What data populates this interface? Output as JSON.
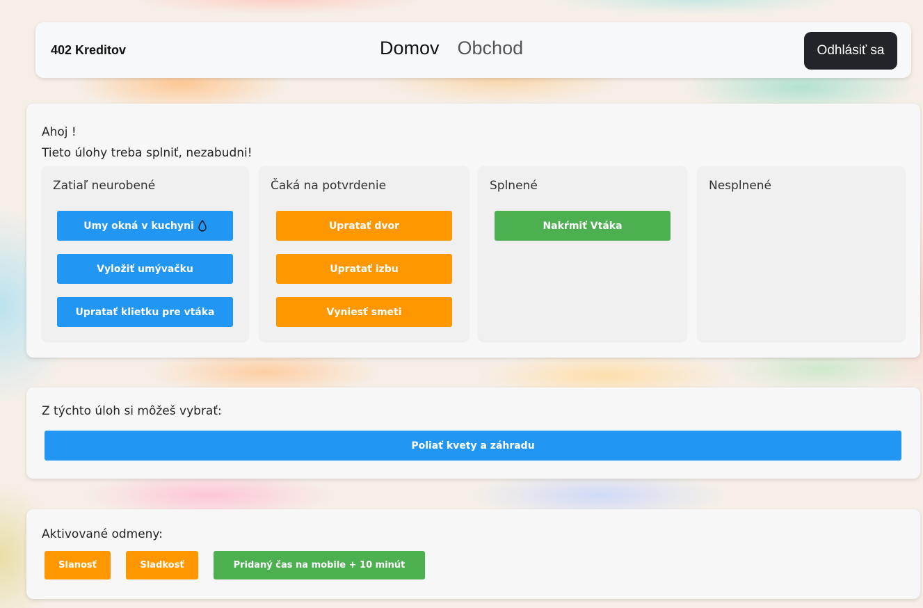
{
  "header": {
    "credits": "402 Kreditov",
    "nav": {
      "home": "Domov",
      "shop": "Obchod"
    },
    "logout_label": "Odhlásiť sa"
  },
  "tasks": {
    "greeting": "Ahoj !",
    "subtitle": "Tieto úlohy treba splniť, nezabudni!",
    "columns": {
      "todo": {
        "title": "Zatiaľ neurobené",
        "items": [
          "Umy okná v kuchyni",
          "Vyložiť umývačku",
          "Upratať klietku pre vtáka"
        ]
      },
      "pending": {
        "title": "Čaká na potvrdenie",
        "items": [
          "Upratať dvor",
          "Upratať izbu",
          "Vyniesť smeti"
        ]
      },
      "done": {
        "title": "Splnené",
        "items": [
          "Nakŕmiť Vtáka"
        ]
      },
      "failed": {
        "title": "Nesplnené",
        "items": []
      }
    }
  },
  "choose": {
    "title": "Z týchto úloh si môžeš vybrať:",
    "items": [
      "Poliať kvety a záhradu"
    ]
  },
  "rewards": {
    "title": "Aktivované odmeny:",
    "items": [
      "Slanosť",
      "Sladkosť",
      "Pridaný čas na mobile + 10 minút"
    ]
  },
  "icons": {
    "todo_item_1": "water-drop-icon"
  },
  "colors": {
    "blue": "#2196f3",
    "orange": "#ff9800",
    "green": "#4caf50",
    "dark": "#212529"
  }
}
